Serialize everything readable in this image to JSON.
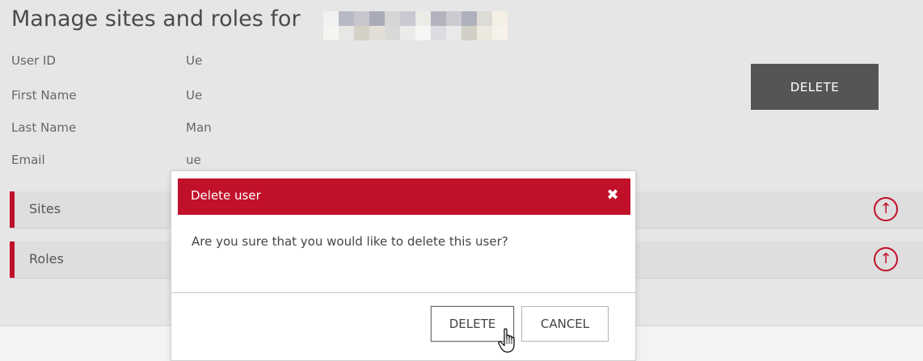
{
  "page": {
    "title": "Manage sites and roles for"
  },
  "user": {
    "fields": [
      {
        "label": "User ID",
        "value": "Ue"
      },
      {
        "label": "First Name",
        "value": "Ue"
      },
      {
        "label": "Last Name",
        "value": "Man"
      },
      {
        "label": "Email",
        "value": "ue"
      }
    ],
    "delete_label": "DELETE"
  },
  "sections": [
    {
      "label": "Sites",
      "icon": "arrow-up-circle-icon"
    },
    {
      "label": "Roles",
      "icon": "arrow-up-circle-icon"
    }
  ],
  "modal": {
    "title": "Delete user",
    "close_icon": "close-icon",
    "message": "Are you sure that you would like to delete this user?",
    "confirm_label": "DELETE",
    "cancel_label": "CANCEL"
  },
  "colors": {
    "accent": "#c0102a",
    "dark_button": "#555555",
    "page_background": "#e6e6e6"
  }
}
